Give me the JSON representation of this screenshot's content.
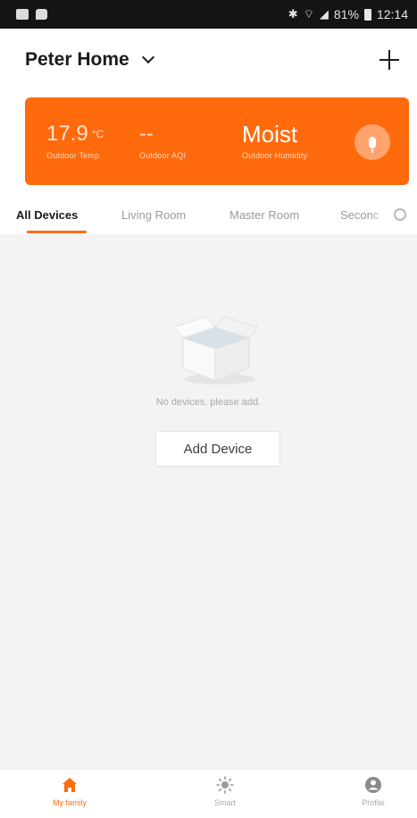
{
  "status_bar": {
    "battery": "81%",
    "time": "12:14"
  },
  "header": {
    "home_name": "Peter Home"
  },
  "weather": {
    "temp_value": "17.9",
    "temp_unit": "°C",
    "temp_label": "Outdoor Temp",
    "aqi_value": "--",
    "aqi_label": "Outdoor AQI",
    "humidity_value": "Moist",
    "humidity_label": "Outdoor Humidity"
  },
  "tabs": [
    {
      "label": "All Devices",
      "active": true
    },
    {
      "label": "Living Room",
      "active": false
    },
    {
      "label": "Master Room",
      "active": false
    },
    {
      "label": "Seconc",
      "active": false
    }
  ],
  "empty_state": {
    "message": "No devices, please add.",
    "add_button": "Add Device"
  },
  "bottom_nav": [
    {
      "label": "My family",
      "icon": "home-icon",
      "active": true
    },
    {
      "label": "Smart",
      "icon": "sun-icon",
      "active": false
    },
    {
      "label": "Profile",
      "icon": "profile-icon",
      "active": false
    }
  ],
  "colors": {
    "accent": "#ff6a0d",
    "background": "#f3f3f3"
  }
}
